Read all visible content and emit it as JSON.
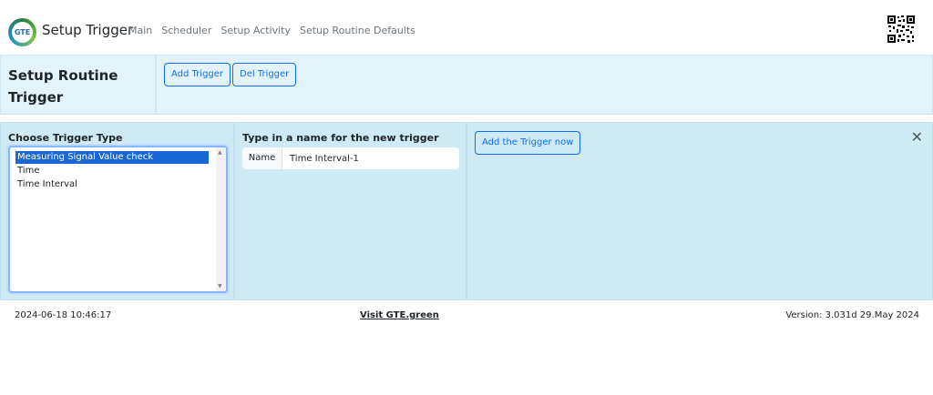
{
  "navbar": {
    "logo_text": "GTE",
    "title": "Setup Trigger",
    "links": [
      "Main",
      "Scheduler",
      "Setup Activity",
      "Setup Routine Defaults"
    ]
  },
  "header": {
    "page_title": "Setup Routine Trigger",
    "add_trigger_label": "Add Trigger",
    "del_trigger_label": "Del Trigger"
  },
  "trigger_type": {
    "title": "Choose Trigger Type",
    "options": [
      "Measuring Signal Value check",
      "Time",
      "Time Interval"
    ],
    "selected": "Measuring Signal Value check"
  },
  "trigger_name": {
    "title": "Type in a name for the new trigger",
    "label": "Name",
    "value": "Time Interval-1"
  },
  "add_now": {
    "button_label": "Add the Trigger now",
    "close_glyph": "✕"
  },
  "footer": {
    "timestamp": "2024-06-18 10:46:17",
    "link": "Visit GTE.green",
    "version": "Version: 3.031d 29.May 2024"
  },
  "colors": {
    "panel_bg": "#cdeaf5",
    "header_bg": "#e3f3fa",
    "accent": "#0d6efd",
    "selected": "#1967d2"
  }
}
